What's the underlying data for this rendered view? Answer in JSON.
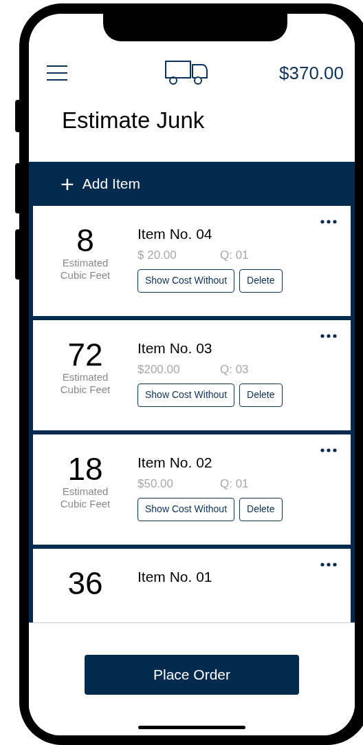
{
  "header": {
    "total": "$370.00"
  },
  "title": "Estimate Junk",
  "add_item": {
    "label": "Add Item",
    "icon": "+"
  },
  "items": [
    {
      "cubic_feet": "8",
      "unit": "Estimated Cubic Feet",
      "name": "Item No. 04",
      "price": "$ 20.00",
      "quantity": "Q: 01",
      "buttons": [
        "Show Cost Without",
        "Delete"
      ]
    },
    {
      "cubic_feet": "72",
      "unit": "Estimated Cubic Feet",
      "name": "Item No. 03",
      "price": "$200.00",
      "quantity": "Q: 03",
      "buttons": [
        "Show Cost Without",
        "Delete"
      ]
    },
    {
      "cubic_feet": "18",
      "unit": "Estimated Cubic Feet",
      "name": "Item No. 02",
      "price": "$50.00",
      "quantity": "Q: 01",
      "buttons": [
        "Show Cost Without",
        "Delete"
      ]
    },
    {
      "cubic_feet": "36",
      "name": "Item No. 01"
    }
  ],
  "footer": {
    "button": "Place Order"
  }
}
